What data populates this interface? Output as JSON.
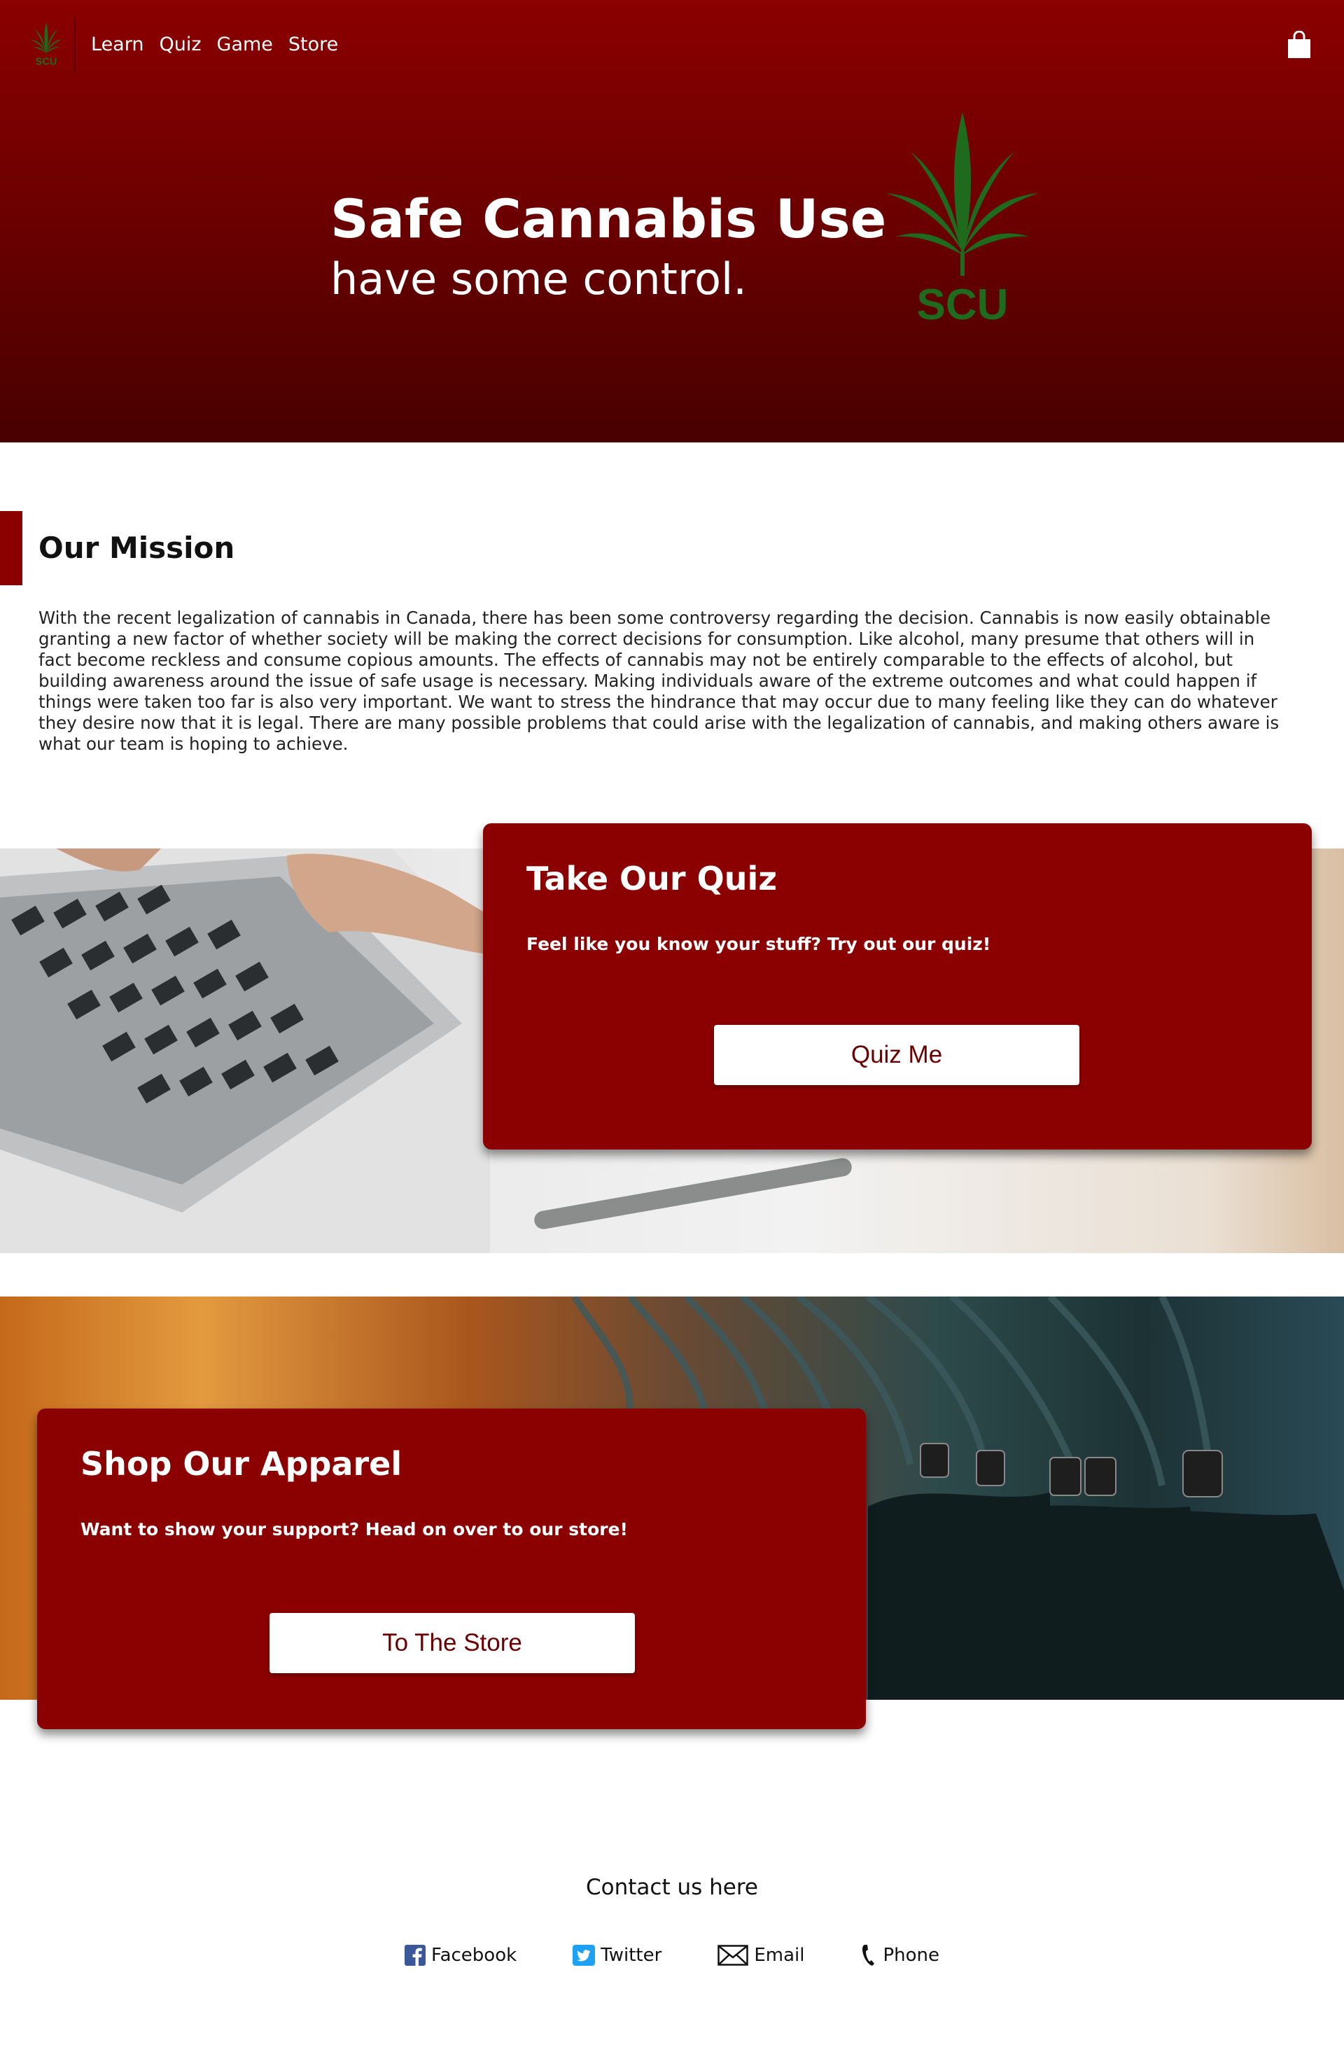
{
  "nav": {
    "items": [
      {
        "label": "Learn"
      },
      {
        "label": "Quiz"
      },
      {
        "label": "Game"
      },
      {
        "label": "Store"
      }
    ]
  },
  "hero": {
    "title": "Safe Cannabis Use",
    "subtitle": "have some control.",
    "logo_text": "SCU"
  },
  "mission": {
    "heading": "Our Mission",
    "body": "With the recent legalization of cannabis in Canada, there has been some controversy regarding the decision. Cannabis is now easily obtainable granting a new factor of whether society will be making the correct decisions for consumption. Like alcohol, many presume that others will in fact become reckless and consume copious amounts. The effects of cannabis may not be entirely comparable to the effects of alcohol, but building awareness around the issue of safe usage is necessary. Making individuals aware of the extreme outcomes and what could happen if things were taken too far is also very important. We want to stress the hindrance that may occur due to many feeling like they can do whatever they desire now that it is legal. There are many possible problems that could arise with the legalization of cannabis, and making others aware is what our team is hoping to achieve."
  },
  "quiz": {
    "title": "Take Our Quiz",
    "text": "Feel like you know your stuff? Try out our quiz!",
    "button": "Quiz Me"
  },
  "store": {
    "title": "Shop Our Apparel",
    "text": "Want to show your support? Head on over to our store!",
    "button": "To The Store"
  },
  "contact": {
    "title": "Contact us here",
    "links": [
      {
        "label": "Facebook",
        "icon": "facebook-icon"
      },
      {
        "label": "Twitter",
        "icon": "twitter-icon"
      },
      {
        "label": "Email",
        "icon": "email-icon"
      },
      {
        "label": "Phone",
        "icon": "phone-icon"
      }
    ]
  },
  "colors": {
    "brand_red": "#8b0000",
    "leaf_green": "#1e6b1e",
    "button_text": "#6a0000"
  }
}
